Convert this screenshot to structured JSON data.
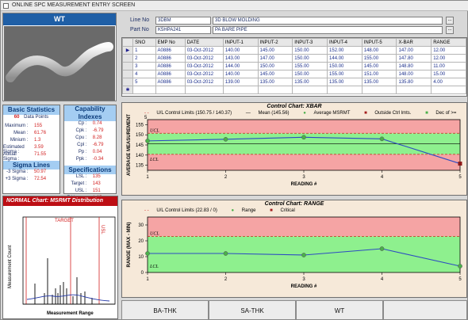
{
  "window": {
    "title": "ONLINE SPC MEASUREMENT ENTRY SCREEN"
  },
  "header": {
    "line_label": "Line No",
    "line_code": "3DBM",
    "line_name": "3D BLOW MOLDING",
    "part_label": "Part No",
    "part_code": "K5HPA241",
    "part_name": "PA BARE PIPE",
    "browse": "..."
  },
  "wt_panel": {
    "title": "WT"
  },
  "table": {
    "columns": [
      "SNO",
      "EMP No",
      "DATE",
      "INPUT-1",
      "INPUT-2",
      "INPUT-3",
      "INPUT-4",
      "INPUT-5",
      "X-BAR",
      "RANGE"
    ],
    "rows": [
      [
        "1",
        "A0886",
        "03-Oct-2012",
        "140.00",
        "145.00",
        "150.00",
        "152.00",
        "148.00",
        "147.00",
        "12.00"
      ],
      [
        "2",
        "A0886",
        "03-Oct-2012",
        "143.00",
        "147.00",
        "150.00",
        "144.00",
        "155.00",
        "147.80",
        "12.00"
      ],
      [
        "3",
        "A0886",
        "03-Oct-2012",
        "144.00",
        "150.00",
        "155.00",
        "150.00",
        "145.00",
        "148.80",
        "11.00"
      ],
      [
        "4",
        "A0886",
        "03-Oct-2012",
        "140.00",
        "145.00",
        "150.00",
        "155.00",
        "151.00",
        "148.00",
        "15.00"
      ],
      [
        "5",
        "A0886",
        "03-Oct-2012",
        "139.00",
        "135.00",
        "135.00",
        "135.00",
        "135.00",
        "135.80",
        "4.00"
      ]
    ]
  },
  "basic_stats": {
    "title": "Basic Statistics",
    "data_points_count": "60",
    "data_points_label": "Data Points",
    "rows": [
      {
        "k": "Maximum :",
        "v": "155"
      },
      {
        "k": "Mean :",
        "v": "61.76"
      },
      {
        "k": "Minium :",
        "v": "1.3"
      },
      {
        "k": "Estimated Sigma :",
        "v": "3.59"
      },
      {
        "k": "Actual Sigma :",
        "v": "71.55"
      }
    ],
    "sigma_title": "Sigma Lines",
    "sigma_rows": [
      {
        "k": "-3 Sigma :",
        "v": "50.97"
      },
      {
        "k": "+3 Sigma :",
        "v": "72.54"
      }
    ]
  },
  "capability": {
    "title": "Capability Indexes",
    "rows": [
      {
        "k": "Cp :",
        "v": "0.74"
      },
      {
        "k": "Cpk :",
        "v": "-6.79"
      },
      {
        "k": "Cpu :",
        "v": "8.28"
      },
      {
        "k": "Cpl :",
        "v": "-6.79"
      },
      {
        "k": "Pp :",
        "v": "0.04"
      },
      {
        "k": "Ppk :",
        "v": "-0.34"
      }
    ],
    "spec_title": "Specifications",
    "spec_rows": [
      {
        "k": "LSL :",
        "v": "135"
      },
      {
        "k": "Target :",
        "v": "143"
      },
      {
        "k": "USL :",
        "v": "151"
      },
      {
        "k": "Z Upper :",
        "v": "1.25"
      }
    ]
  },
  "normal_chart": {
    "title": "NORMAL Chart: MSRMT Distribution",
    "target_label": "TARGET",
    "lsl_label": "LSL",
    "usl_label": "USL",
    "ylabel": "Measurement Count",
    "xlabel": "Measurement Range"
  },
  "xbar_chart": {
    "title": "Control Chart: XBAR",
    "legend": [
      "U/L Control Limits (150.75 / 140.37)",
      "Mean (145.56)",
      "Average MSRMT",
      "Outside Ctrl lmts.",
      "Dec of >= 5"
    ],
    "ylabel": "AVERAGE MEASUREMENT",
    "xlabel": "READING #",
    "ucl": "UCL",
    "lcl": "LCL",
    "yticks": [
      "135",
      "140",
      "145",
      "150",
      "155"
    ],
    "xticks": [
      "1",
      "2",
      "3",
      "4",
      "5"
    ]
  },
  "range_chart": {
    "title": "Control Chart: RANGE",
    "legend": [
      "U/L Control Limits (22.83 / 0)",
      "Range",
      "Critical"
    ],
    "ylabel": "RANGE (MAX - MIN)",
    "xlabel": "READING #",
    "ucl": "UCL",
    "lcl": "LCL",
    "yticks": [
      "0",
      "10",
      "20",
      "30"
    ],
    "xticks": [
      "1",
      "2",
      "3",
      "4",
      "5"
    ]
  },
  "tabs": [
    {
      "label": "BA-THK"
    },
    {
      "label": "SA-THK"
    },
    {
      "label": "WT"
    }
  ],
  "chart_data": [
    {
      "type": "line",
      "x": [
        1,
        2,
        3,
        4,
        5
      ],
      "series": [
        {
          "values": [
            147.0,
            147.8,
            148.8,
            148.0,
            135.8
          ]
        }
      ],
      "ylim": [
        132.5,
        157.5
      ],
      "xlabel": "READING #",
      "ylabel": "AVERAGE MEASUREMENT",
      "title": "Control Chart: XBAR",
      "controls": {
        "ucl": 150.75,
        "lcl": 140.37,
        "mean": 145.56
      },
      "outside": [
        5
      ]
    },
    {
      "type": "line",
      "x": [
        1,
        2,
        3,
        4,
        5
      ],
      "series": [
        {
          "values": [
            12.0,
            12.0,
            11.0,
            15.0,
            4.0
          ]
        }
      ],
      "ylim": [
        0,
        35
      ],
      "xlabel": "READING #",
      "ylabel": "RANGE (MAX - MIN)",
      "title": "Control Chart: RANGE",
      "controls": {
        "ucl": 22.83,
        "lcl": 0
      }
    }
  ]
}
